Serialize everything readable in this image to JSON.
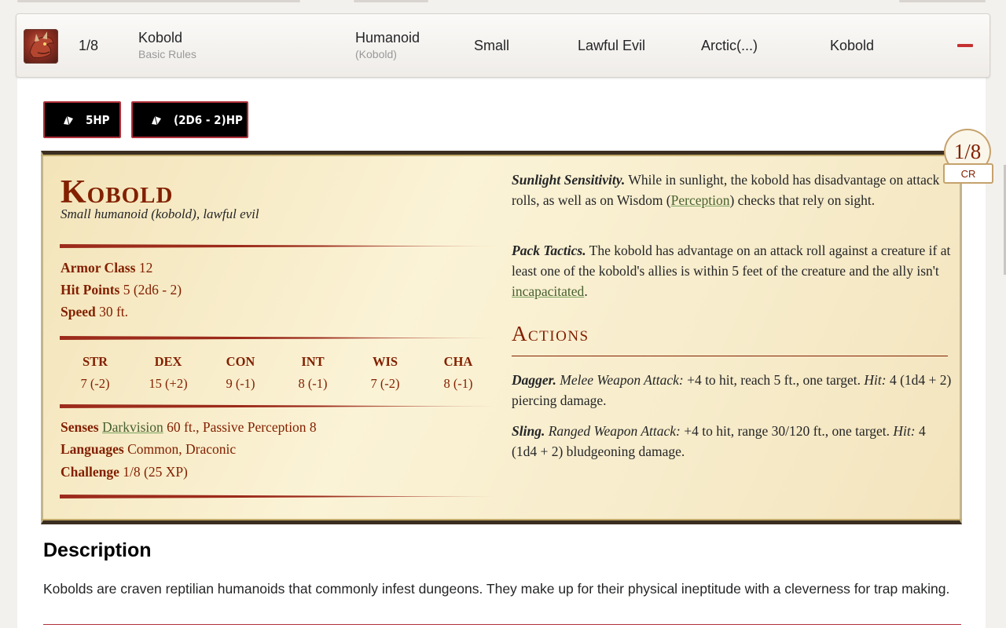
{
  "monster_row": {
    "cr": "1/8",
    "name": "Kobold",
    "source": "Basic Rules",
    "type": "Humanoid",
    "subtype": "(Kobold)",
    "size": "Small",
    "alignment": "Lawful Evil",
    "environment": "Arctic(...)",
    "tag": "Kobold",
    "avatar_icon": "kobold-portrait",
    "remove_icon": "minus-icon"
  },
  "hp_buttons": [
    {
      "label": "5HP",
      "icon": "dice-icon"
    },
    {
      "label": "(2D6 - 2)HP",
      "icon": "dice-icon"
    }
  ],
  "statblock": {
    "name": "Kobold",
    "meta": "Small humanoid (kobold), lawful evil",
    "armor_class": {
      "label": "Armor Class",
      "value": "12"
    },
    "hit_points": {
      "label": "Hit Points",
      "value": "5 (2d6 - 2)"
    },
    "speed": {
      "label": "Speed",
      "value": "30 ft."
    },
    "abilities": [
      {
        "name": "STR",
        "score": "7",
        "mod": "(-2)"
      },
      {
        "name": "DEX",
        "score": "15",
        "mod": "(+2)"
      },
      {
        "name": "CON",
        "score": "9",
        "mod": "(-1)"
      },
      {
        "name": "INT",
        "score": "8",
        "mod": "(-1)"
      },
      {
        "name": "WIS",
        "score": "7",
        "mod": "(-2)"
      },
      {
        "name": "CHA",
        "score": "8",
        "mod": "(-1)"
      }
    ],
    "senses": {
      "label": "Senses",
      "link": "Darkvision",
      "rest": "60 ft., Passive Perception 8"
    },
    "languages": {
      "label": "Languages",
      "value": "Common, Draconic"
    },
    "challenge": {
      "label": "Challenge",
      "value": "1/8 (25 XP)"
    },
    "traits": {
      "sunlight_title": "Sunlight Sensitivity.",
      "sunlight_text_1": "While in sunlight, the kobold has disadvantage on attack rolls, as well as on Wisdom (",
      "sunlight_link": "Perception",
      "sunlight_text_2": ") checks that rely on sight.",
      "pack_title": "Pack Tactics.",
      "pack_text_1": "The kobold has advantage on an attack roll against a creature if at least one of the kobold's allies is within 5 feet of the creature and the ally isn't",
      "pack_link": "incapacitated",
      "pack_text_2": "."
    },
    "actions_heading": "Actions",
    "actions": {
      "dagger_title": "Dagger.",
      "dagger_type": "Melee Weapon Attack:",
      "dagger_text_1": "+4 to hit, reach 5 ft., one target.",
      "dagger_hit": "Hit:",
      "dagger_text_2": "4 (1d4 + 2) piercing damage.",
      "sling_title": "Sling.",
      "sling_type": "Ranged Weapon Attack:",
      "sling_text_1": "+4 to hit, range 30/120 ft., one target.",
      "sling_hit": "Hit:",
      "sling_text_2": "4 (1d4 + 2) bludgeoning damage."
    },
    "cr_badge": {
      "value": "1/8",
      "label": "CR"
    }
  },
  "description": {
    "heading": "Description",
    "text": "Kobolds are craven reptilian humanoids that commonly infest dungeons. They make up for their physical ineptitude with a cleverness for trap making."
  }
}
